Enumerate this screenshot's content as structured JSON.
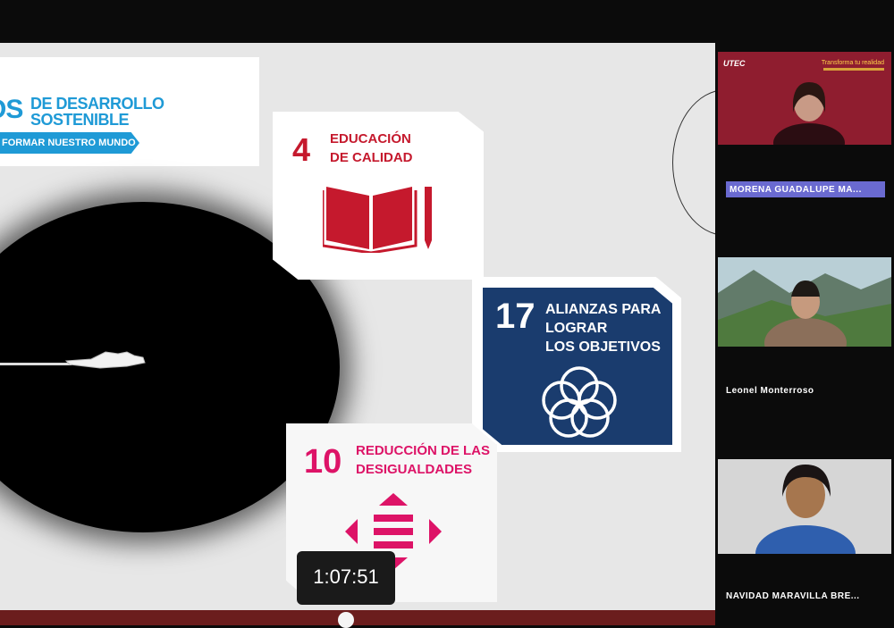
{
  "banner": {
    "letters": "OS",
    "line1": "DE DESARROLLO",
    "line2": "SOSTENIBLE",
    "ribbon": "FORMAR NUESTRO MUNDO"
  },
  "cards": [
    {
      "number": "4",
      "title_line1": "EDUCACIÓN",
      "title_line2": "DE CALIDAD",
      "color": "#c5192d"
    },
    {
      "number": "17",
      "title_line1": "ALIANZAS PARA",
      "title_line2": "LOGRAR",
      "title_line3": "LOS OBJETIVOS",
      "color": "#1a3c6e"
    },
    {
      "number": "10",
      "title_line1": "REDUCCIÓN DE LAS",
      "title_line2": "DESIGUALDADES",
      "color": "#dd1367"
    }
  ],
  "participants": [
    {
      "name": "MORENA GUADALUPE MA..."
    },
    {
      "name": "Leonel Monterroso"
    },
    {
      "name": "NAVIDAD MARAVILLA BRE..."
    }
  ],
  "tile1": {
    "logo": "UTEC",
    "tagline": "Transforma tu realidad"
  },
  "video": {
    "timestamp": "1:07:51"
  }
}
